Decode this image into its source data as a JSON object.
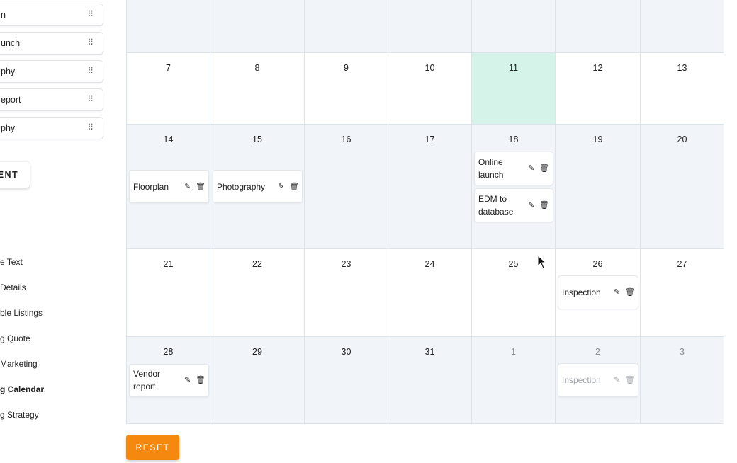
{
  "sidebar": {
    "cards": [
      {
        "label": "n"
      },
      {
        "label": "unch"
      },
      {
        "label": "phy"
      },
      {
        "label": "eport"
      },
      {
        "label": "phy"
      }
    ],
    "drag_glyph": "⠿",
    "event_button_label": "ENT",
    "nav": [
      {
        "label": "e Text"
      },
      {
        "label": "Details"
      },
      {
        "label": "ble Listings"
      },
      {
        "label": "g Quote"
      },
      {
        "label": "Marketing"
      },
      {
        "label": "g Calendar"
      },
      {
        "label": "g Strategy"
      }
    ]
  },
  "calendar": {
    "rows": [
      [
        "",
        "",
        "",
        "",
        "",
        "",
        ""
      ],
      [
        "7",
        "8",
        "9",
        "10",
        "11",
        "12",
        "13"
      ],
      [
        "14",
        "15",
        "16",
        "17",
        "18",
        "19",
        "20"
      ],
      [
        "21",
        "22",
        "23",
        "24",
        "25",
        "26",
        "27"
      ],
      [
        "28",
        "29",
        "30",
        "31",
        "1",
        "2",
        "3"
      ]
    ],
    "events": {
      "floorplan": "Floorplan",
      "photography": "Photography",
      "online_launch_1": "Online",
      "online_launch_2": "launch",
      "edm_1": "EDM to",
      "edm_2": "database",
      "inspection": "Inspection",
      "vendor_1": "Vendor",
      "vendor_2": "report",
      "inspection_next": "Inspection"
    },
    "edit_glyph": "✎",
    "delete_glyph": "🗑"
  },
  "reset_label": "RESET",
  "colors": {
    "today": "#d6f3ea",
    "shaded": "#f1f4f8",
    "accent": "#f5880f"
  }
}
